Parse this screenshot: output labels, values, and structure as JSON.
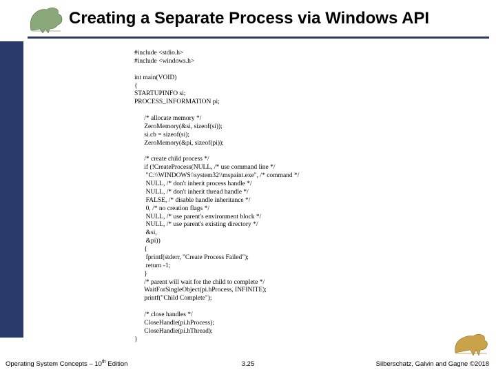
{
  "header": {
    "title": "Creating a Separate Process via Windows API"
  },
  "code": {
    "lines": "#include <stdio.h>\n#include <windows.h>\n\nint main(VOID)\n{\nSTARTUPINFO si;\nPROCESS_INFORMATION pi;\n\n      /* allocate memory */\n      ZeroMemory(&si, sizeof(si));\n      si.cb = sizeof(si);\n      ZeroMemory(&pi, sizeof(pi));\n\n      /* create child process */\n      if (!CreateProcess(NULL, /* use command line */\n       \"C:\\\\WINDOWS\\\\system32\\\\mspaint.exe\", /* command */\n       NULL, /* don't inherit process handle */\n       NULL, /* don't inherit thread handle */\n       FALSE, /* disable handle inheritance */\n       0, /* no creation flags */\n       NULL, /* use parent's environment block */\n       NULL, /* use parent's existing directory */\n       &si,\n       &pi))\n      {\n       fprintf(stderr, \"Create Process Failed\");\n       return -1;\n      }\n      /* parent will wait for the child to complete */\n      WaitForSingleObject(pi.hProcess, INFINITE);\n      printf(\"Child Complete\");\n\n      /* close handles */\n      CloseHandle(pi.hProcess);\n      CloseHandle(pi.hThread);\n}"
  },
  "footer": {
    "left_prefix": "Operating System Concepts – 10",
    "left_super": "th",
    "left_suffix": " Edition",
    "center": "3.25",
    "right": "Silberschatz, Galvin and Gagne ©2018"
  }
}
